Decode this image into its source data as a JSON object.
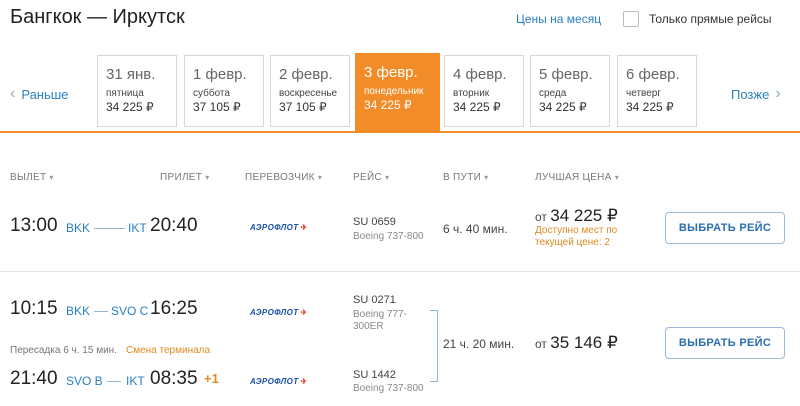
{
  "header": {
    "title": "Бангкок — Иркутск",
    "month_prices_link": "Цены на месяц",
    "direct_only_label": "Только прямые рейсы",
    "direct_only_checked": false
  },
  "date_nav": {
    "earlier_label": "Раньше",
    "later_label": "Позже",
    "dates": [
      {
        "date": "31 янв.",
        "weekday": "пятница",
        "price": "34 225 ₽"
      },
      {
        "date": "1 февр.",
        "weekday": "суббота",
        "price": "37 105 ₽"
      },
      {
        "date": "2 февр.",
        "weekday": "воскресенье",
        "price": "37 105 ₽"
      },
      {
        "date": "3 февр.",
        "weekday": "понедельник",
        "price": "34 225 ₽",
        "selected": true
      },
      {
        "date": "4 февр.",
        "weekday": "вторник",
        "price": "34 225 ₽"
      },
      {
        "date": "5 февр.",
        "weekday": "среда",
        "price": "34 225 ₽"
      },
      {
        "date": "6 февр.",
        "weekday": "четверг",
        "price": "34 225 ₽"
      }
    ],
    "accent_color": "#f28c28"
  },
  "columns": {
    "departure": "ВЫЛЕТ",
    "arrival": "ПРИЛЕТ",
    "carrier": "ПЕРЕВОЗЧИК",
    "flight": "РЕЙС",
    "duration": "В ПУТИ",
    "best_price": "ЛУЧШАЯ ЦЕНА"
  },
  "results": [
    {
      "dep_time": "13:00",
      "from": "BKK",
      "to": "IKT",
      "arr_time": "20:40",
      "carrier_logo": "АЭРОФЛОТ",
      "flight": "SU 0659",
      "aircraft": "Boeing 737-800",
      "duration": "6 ч. 40 мин.",
      "price_prefix": "от",
      "price": "34 225 ₽",
      "seats_note_1": "Доступно мест по",
      "seats_note_2": "текущей цене: 2",
      "button": "ВЫБРАТЬ РЕЙС"
    },
    {
      "leg1": {
        "dep_time": "10:15",
        "from": "BKK",
        "to": "SVO C",
        "arr_time": "16:25",
        "carrier_logo": "АЭРОФЛОТ",
        "flight": "SU 0271",
        "aircraft_1": "Boeing 777-",
        "aircraft_2": "300ER"
      },
      "transfer": "Пересадка 6 ч. 15 мин.",
      "terminal_change": "Смена терминала",
      "leg2": {
        "dep_time": "21:40",
        "from": "SVO B",
        "to": "IKT",
        "arr_time": "08:35",
        "next_day": "+1",
        "carrier_logo": "АЭРОФЛОТ",
        "flight": "SU 1442",
        "aircraft": "Boeing 737-800"
      },
      "duration": "21 ч. 20 мин.",
      "price_prefix": "от",
      "price": "35 146 ₽",
      "button": "ВЫБРАТЬ РЕЙС"
    }
  ]
}
